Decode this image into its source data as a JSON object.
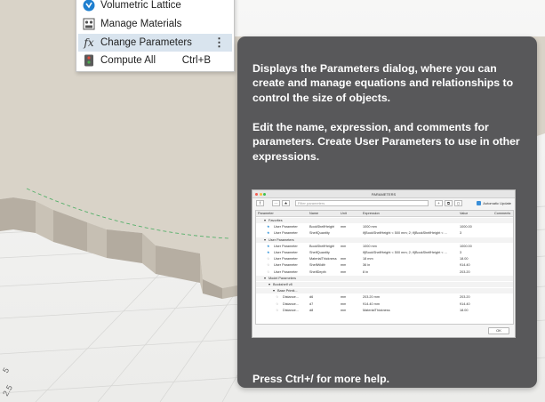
{
  "colors": {
    "viewport_bg": "#f3f3f2",
    "gear_top": "#d9d3c8",
    "gear_side": "#b6aea2",
    "tooltip_bg": "#58585a",
    "menu_highlight": "#d9e4ee",
    "accent": "#2a8fd6"
  },
  "viewport": {
    "axis_labels": [
      "5",
      "2.5"
    ]
  },
  "context_menu": {
    "items": [
      {
        "label": "Volumetric Lattice",
        "icon": "volumetric-lattice-icon",
        "shortcut": ""
      },
      {
        "label": "Manage Materials",
        "icon": "manage-materials-icon",
        "shortcut": ""
      },
      {
        "label": "Change Parameters",
        "icon": "fx-icon",
        "shortcut": "",
        "active": true,
        "icon_glyph": "fx"
      },
      {
        "label": "Compute All",
        "icon": "compute-all-icon",
        "shortcut": "Ctrl+B"
      }
    ],
    "more_glyph": "⋮"
  },
  "tooltip": {
    "description_1": "Displays the Parameters dialog, where you can create and manage equations and relationships to control the size of objects.",
    "description_2": "Edit the name, expression, and comments for parameters. Create User Parameters to use in other expressions.",
    "help_text": "Press Ctrl+/ for more help."
  },
  "parameters_preview": {
    "title": "PARAMETERS",
    "filter_placeholder": "Filter parameters",
    "auto_update_label": "Automatic Update",
    "ok_label": "OK",
    "columns": [
      "Parameter",
      "Name",
      "Unit",
      "Expression",
      "Value",
      "Comments"
    ],
    "rows": [
      {
        "kind": "group",
        "label": "Favorites",
        "indent": 1
      },
      {
        "kind": "param",
        "star": true,
        "param": "User Parameter",
        "name": "BookShelfHeight",
        "unit": "mm",
        "expr": "1000 mm",
        "value": "1000.00"
      },
      {
        "kind": "param",
        "star": true,
        "param": "User Parameter",
        "name": "ShelfQuantity",
        "unit": "",
        "expr": "if(BookShelfHeight < 500 mm; 2; if(BookShelfHeight < ...",
        "value": "3"
      },
      {
        "kind": "group",
        "label": "User Parameters",
        "indent": 1
      },
      {
        "kind": "param",
        "star": true,
        "param": "User Parameter",
        "name": "BookShelfHeight",
        "unit": "mm",
        "expr": "1000 mm",
        "value": "1000.00"
      },
      {
        "kind": "param",
        "star": true,
        "param": "User Parameter",
        "name": "ShelfQuantity",
        "unit": "",
        "expr": "if(BookShelfHeight < 500 mm; 2; if(BookShelfHeight < ...",
        "value": "3"
      },
      {
        "kind": "param",
        "star": false,
        "param": "User Parameter",
        "name": "MaterialThickness",
        "unit": "mm",
        "expr": "18 mm",
        "value": "18.00"
      },
      {
        "kind": "param",
        "star": false,
        "param": "User Parameter",
        "name": "ShelfWidth",
        "unit": "mm",
        "expr": "36 in",
        "value": "914.40"
      },
      {
        "kind": "param",
        "star": false,
        "param": "User Parameter",
        "name": "ShelfDepth",
        "unit": "mm",
        "expr": "8 in",
        "value": "203.20"
      },
      {
        "kind": "group",
        "label": "Model Parameters",
        "indent": 1
      },
      {
        "kind": "group",
        "label": "Bookshelf v8",
        "indent": 2
      },
      {
        "kind": "group",
        "label": "Base Primit...",
        "indent": 3
      },
      {
        "kind": "param",
        "star": false,
        "param": "Distance...",
        "name": "d6",
        "unit": "mm",
        "expr": "203.20 mm",
        "value": "203.20",
        "indent": 4
      },
      {
        "kind": "param",
        "star": false,
        "param": "Distance...",
        "name": "d7",
        "unit": "mm",
        "expr": "914.40 mm",
        "value": "914.40",
        "indent": 4
      },
      {
        "kind": "param",
        "star": false,
        "param": "Distance...",
        "name": "d8",
        "unit": "mm",
        "expr": "MaterialThickness",
        "value": "18.00",
        "indent": 4
      }
    ]
  }
}
